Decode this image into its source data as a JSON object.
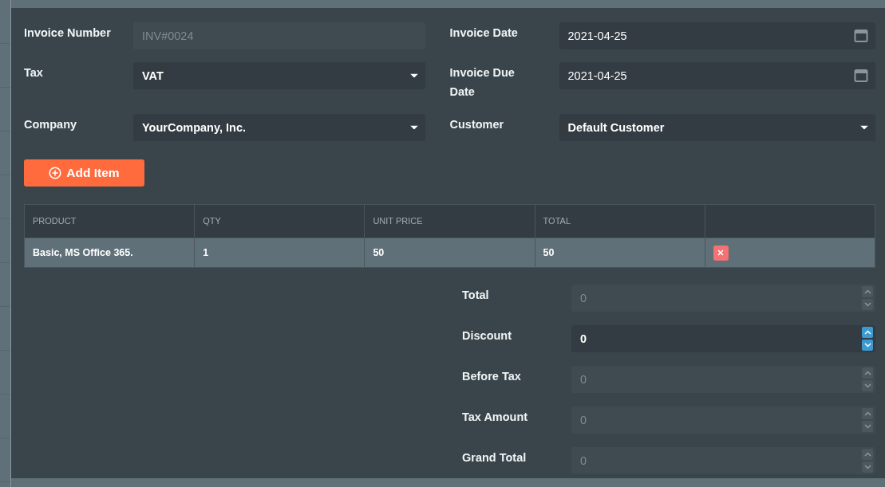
{
  "form_fields": [
    {
      "label": "Invoice Number",
      "kind": "text",
      "value": "INV#0024",
      "disabled": true
    },
    {
      "label": "Invoice Date",
      "kind": "date",
      "value": "2021-04-25",
      "disabled": false
    },
    {
      "label": "Tax",
      "kind": "select",
      "value": "VAT",
      "disabled": false
    },
    {
      "label": "Invoice Due Date",
      "kind": "date",
      "value": "2021-04-25",
      "disabled": false
    },
    {
      "label": "Company",
      "kind": "select",
      "value": "YourCompany, Inc.",
      "disabled": false
    },
    {
      "label": "Customer",
      "kind": "select",
      "value": "Default Customer",
      "disabled": false
    }
  ],
  "add_item_button": {
    "label": "Add Item"
  },
  "table": {
    "columns": [
      "PRODUCT",
      "QTY",
      "UNIT PRICE",
      "TOTAL"
    ],
    "rows": [
      {
        "cells": [
          "Basic, MS Office 365.",
          "1",
          "50",
          "50"
        ]
      }
    ]
  },
  "summary": [
    {
      "label": "Total",
      "value": "0",
      "disabled": true,
      "focused": false
    },
    {
      "label": "Discount",
      "value": "0",
      "disabled": false,
      "focused": true
    },
    {
      "label": "Before Tax",
      "value": "0",
      "disabled": true,
      "focused": false
    },
    {
      "label": "Tax Amount",
      "value": "0",
      "disabled": true,
      "focused": false
    },
    {
      "label": "Grand Total",
      "value": "0",
      "disabled": true,
      "focused": false
    }
  ]
}
